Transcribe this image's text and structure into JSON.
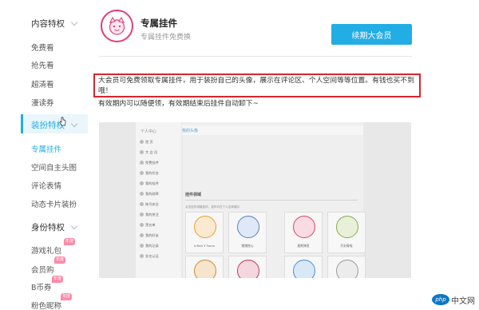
{
  "sidebar": {
    "sections": [
      {
        "title": "内容特权",
        "items": [
          "免费看",
          "抢先看",
          "超清看",
          "漫读券"
        ]
      },
      {
        "title": "装扮特权",
        "items": [
          "专属挂件",
          "空间自主头图",
          "评论表情",
          "动态卡片装扮"
        ]
      },
      {
        "title": "身份特权",
        "items": [
          "游戏礼包",
          "会员购",
          "B币券",
          "粉色昵称"
        ]
      }
    ],
    "badge": "年度"
  },
  "header": {
    "title": "专属挂件",
    "subtitle": "专属挂件免费换",
    "renew_button": "续期大会员"
  },
  "description": {
    "line1": "大会员可免费领取专属挂件，用于装扮自己的头像，展示在评论区、个人空间等等位置。有钱也买不到哦！",
    "line2": "有效期内可以随便领，有效期结束后挂件自动卸下~"
  },
  "embedded": {
    "side_title": "个人中心",
    "tab": "我的头像",
    "menu": [
      "首 页",
      "大 会 员",
      "免费挂件",
      "我的任务",
      "我的挂件",
      "我的勋章",
      "账号安全",
      "我的关注",
      "黑名单",
      "我的好友",
      "我的记录",
      "实名认证"
    ],
    "section_label": "挂件领域",
    "small_text": "点击挂件领取挂件，挂件可在个人空间展示",
    "pendants": [
      "Infinit Y Force",
      "猪猪侠心",
      "星期弹息",
      "开封青蛙",
      "",
      "",
      "",
      ""
    ]
  },
  "watermark": {
    "logo": "php",
    "text": "中文网"
  }
}
